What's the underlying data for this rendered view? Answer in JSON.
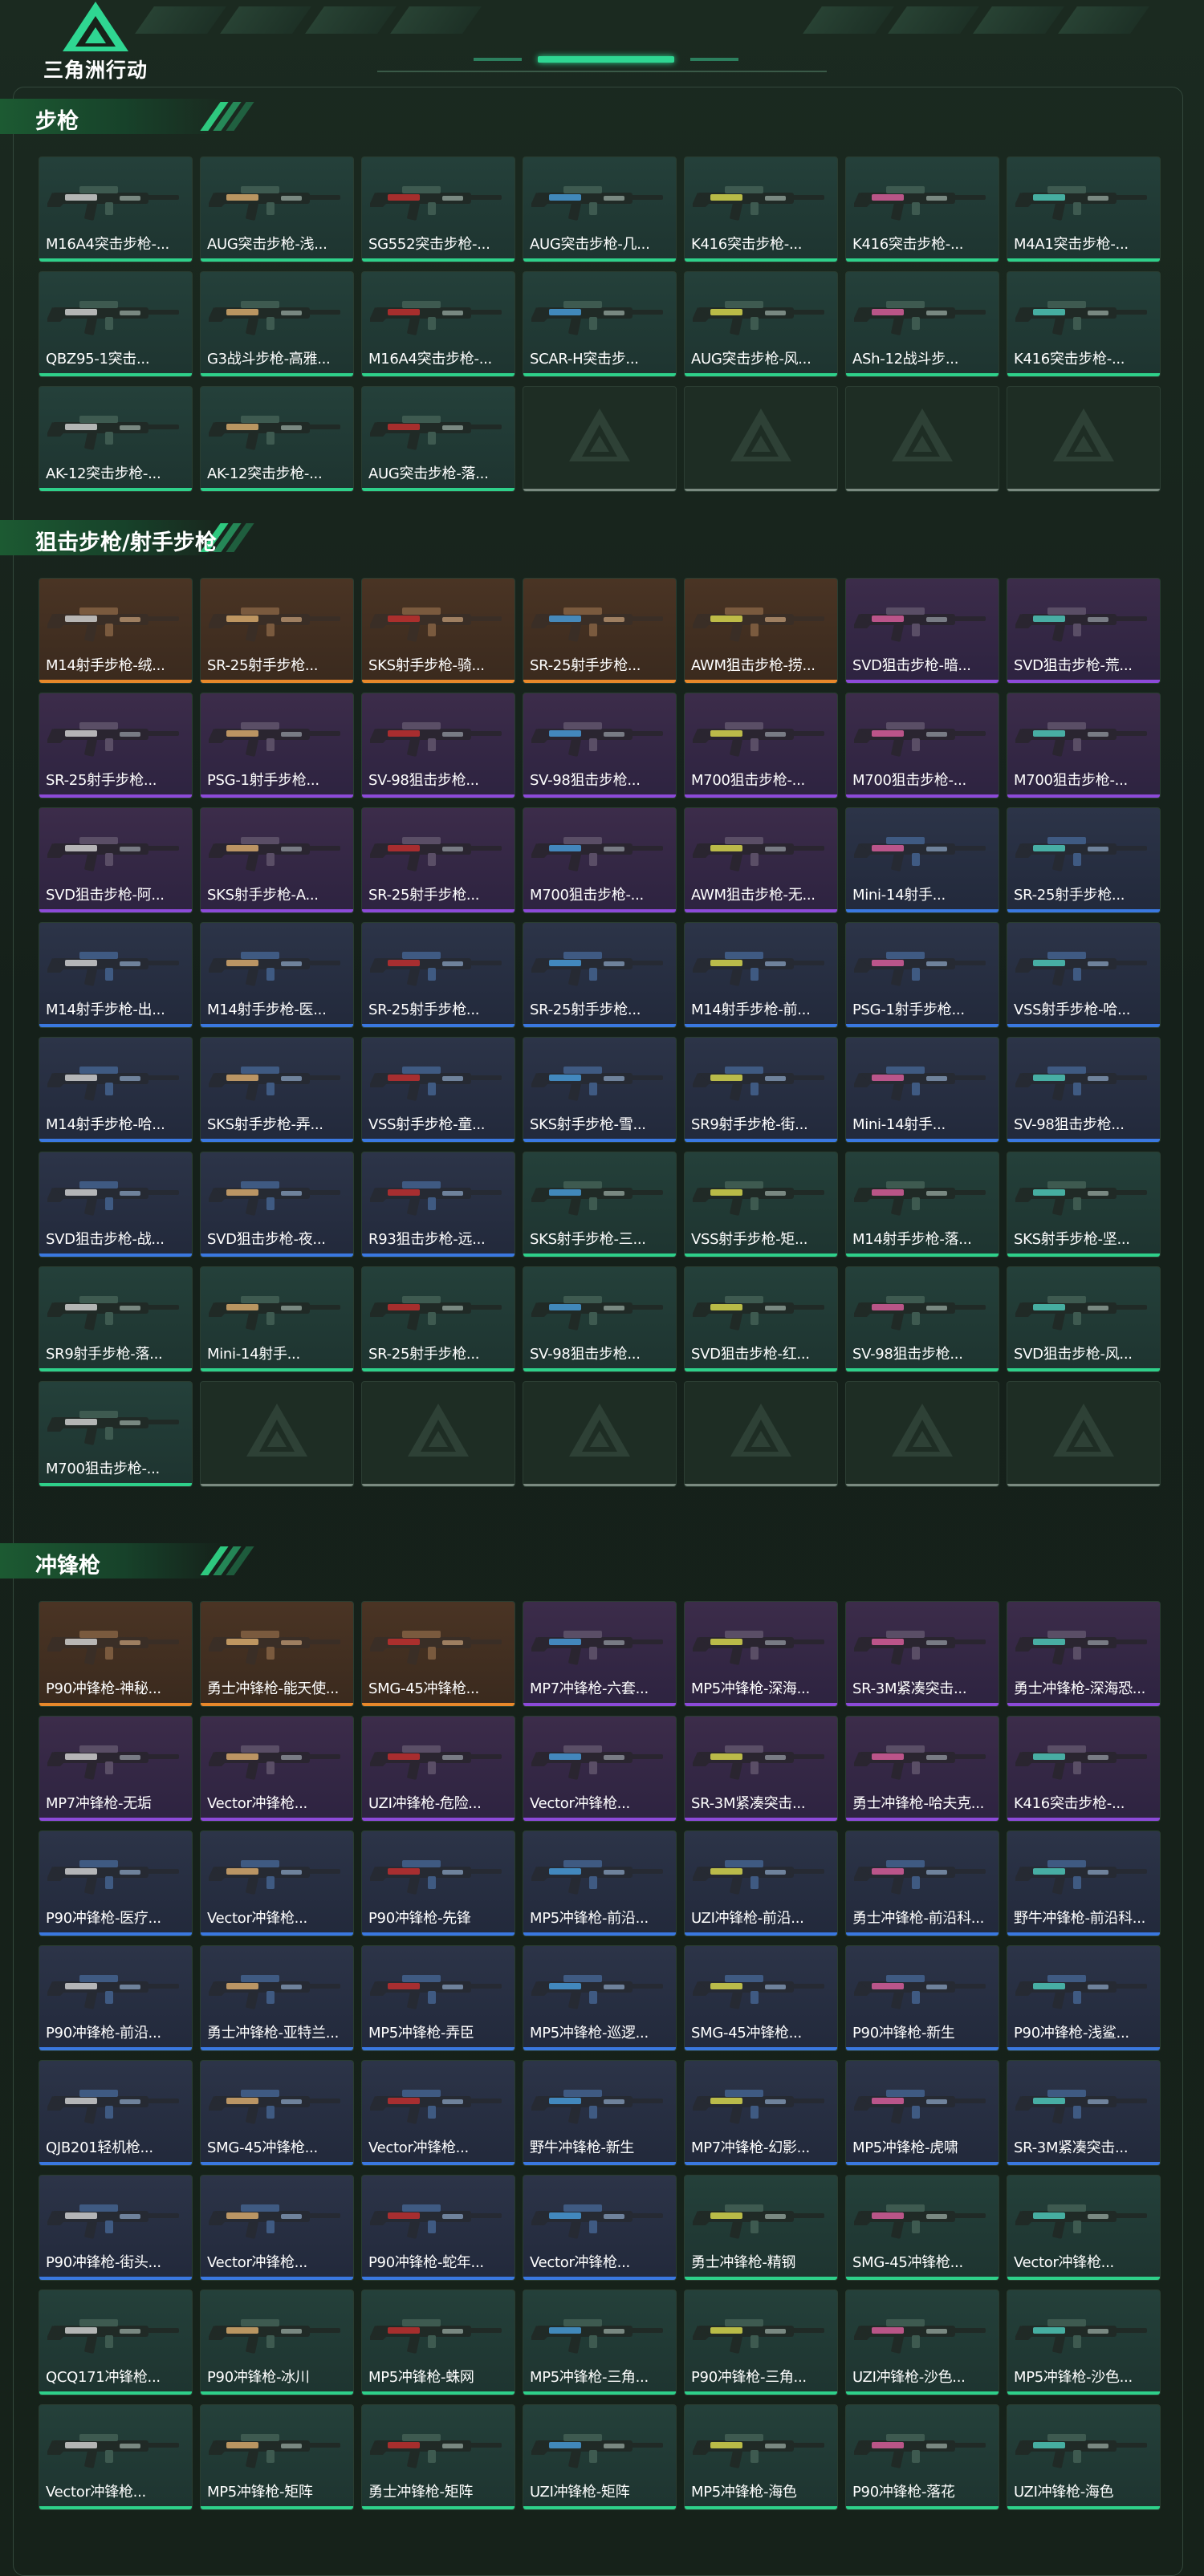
{
  "header": {
    "logo_text": "三角洲行动"
  },
  "sections": [
    {
      "title": "步枪",
      "items": [
        {
          "label": "M16A4突击步枪-...",
          "rarity": "green"
        },
        {
          "label": "AUG突击步枪-浅...",
          "rarity": "green"
        },
        {
          "label": "SG552突击步枪-...",
          "rarity": "green"
        },
        {
          "label": "AUG突击步枪-几...",
          "rarity": "green"
        },
        {
          "label": "K416突击步枪-...",
          "rarity": "green"
        },
        {
          "label": "K416突击步枪-...",
          "rarity": "green"
        },
        {
          "label": "M4A1突击步枪-...",
          "rarity": "green"
        },
        {
          "label": "QBZ95-1突击...",
          "rarity": "green"
        },
        {
          "label": "G3战斗步枪-高雅...",
          "rarity": "green"
        },
        {
          "label": "M16A4突击步枪-...",
          "rarity": "green"
        },
        {
          "label": "SCAR-H突击步...",
          "rarity": "green"
        },
        {
          "label": "AUG突击步枪-风...",
          "rarity": "green"
        },
        {
          "label": "ASh-12战斗步...",
          "rarity": "green"
        },
        {
          "label": "K416突击步枪-...",
          "rarity": "green"
        },
        {
          "label": "AK-12突击步枪-...",
          "rarity": "green"
        },
        {
          "label": "AK-12突击步枪-...",
          "rarity": "green"
        },
        {
          "label": "AUG突击步枪-落...",
          "rarity": "green"
        },
        {
          "label": "",
          "rarity": "empty"
        },
        {
          "label": "",
          "rarity": "empty"
        },
        {
          "label": "",
          "rarity": "empty"
        },
        {
          "label": "",
          "rarity": "empty"
        }
      ]
    },
    {
      "title": "狙击步枪/射手步枪",
      "items": [
        {
          "label": "M14射手步枪-绒...",
          "rarity": "gold"
        },
        {
          "label": "SR-25射手步枪...",
          "rarity": "gold"
        },
        {
          "label": "SKS射手步枪-骑...",
          "rarity": "gold"
        },
        {
          "label": "SR-25射手步枪...",
          "rarity": "gold"
        },
        {
          "label": "AWM狙击步枪-捞...",
          "rarity": "gold"
        },
        {
          "label": "SVD狙击步枪-暗...",
          "rarity": "purple"
        },
        {
          "label": "SVD狙击步枪-荒...",
          "rarity": "purple"
        },
        {
          "label": "SR-25射手步枪...",
          "rarity": "purple"
        },
        {
          "label": "PSG-1射手步枪...",
          "rarity": "purple"
        },
        {
          "label": "SV-98狙击步枪...",
          "rarity": "purple"
        },
        {
          "label": "SV-98狙击步枪...",
          "rarity": "purple"
        },
        {
          "label": "M700狙击步枪-...",
          "rarity": "purple"
        },
        {
          "label": "M700狙击步枪-...",
          "rarity": "purple"
        },
        {
          "label": "M700狙击步枪-...",
          "rarity": "purple"
        },
        {
          "label": "SVD狙击步枪-阿...",
          "rarity": "purple"
        },
        {
          "label": "SKS射手步枪-A...",
          "rarity": "purple"
        },
        {
          "label": "SR-25射手步枪...",
          "rarity": "purple"
        },
        {
          "label": "M700狙击步枪-...",
          "rarity": "purple"
        },
        {
          "label": "AWM狙击步枪-无...",
          "rarity": "purple"
        },
        {
          "label": "Mini-14射手...",
          "rarity": "blue"
        },
        {
          "label": "SR-25射手步枪...",
          "rarity": "blue"
        },
        {
          "label": "M14射手步枪-出...",
          "rarity": "blue"
        },
        {
          "label": "M14射手步枪-医...",
          "rarity": "blue"
        },
        {
          "label": "SR-25射手步枪...",
          "rarity": "blue"
        },
        {
          "label": "SR-25射手步枪...",
          "rarity": "blue"
        },
        {
          "label": "M14射手步枪-前...",
          "rarity": "blue"
        },
        {
          "label": "PSG-1射手步枪...",
          "rarity": "blue"
        },
        {
          "label": "VSS射手步枪-哈...",
          "rarity": "blue"
        },
        {
          "label": "M14射手步枪-哈...",
          "rarity": "blue"
        },
        {
          "label": "SKS射手步枪-弄...",
          "rarity": "blue"
        },
        {
          "label": "VSS射手步枪-童...",
          "rarity": "blue"
        },
        {
          "label": "SKS射手步枪-雪...",
          "rarity": "blue"
        },
        {
          "label": "SR9射手步枪-街...",
          "rarity": "blue"
        },
        {
          "label": "Mini-14射手...",
          "rarity": "blue"
        },
        {
          "label": "SV-98狙击步枪...",
          "rarity": "blue"
        },
        {
          "label": "SVD狙击步枪-战...",
          "rarity": "blue"
        },
        {
          "label": "SVD狙击步枪-夜...",
          "rarity": "blue"
        },
        {
          "label": "R93狙击步枪-远...",
          "rarity": "blue"
        },
        {
          "label": "SKS射手步枪-三...",
          "rarity": "green"
        },
        {
          "label": "VSS射手步枪-矩...",
          "rarity": "green"
        },
        {
          "label": "M14射手步枪-落...",
          "rarity": "green"
        },
        {
          "label": "SKS射手步枪-坚...",
          "rarity": "green"
        },
        {
          "label": "SR9射手步枪-落...",
          "rarity": "green"
        },
        {
          "label": "Mini-14射手...",
          "rarity": "green"
        },
        {
          "label": "SR-25射手步枪...",
          "rarity": "green"
        },
        {
          "label": "SV-98狙击步枪...",
          "rarity": "green"
        },
        {
          "label": "SVD狙击步枪-红...",
          "rarity": "green"
        },
        {
          "label": "SV-98狙击步枪...",
          "rarity": "green"
        },
        {
          "label": "SVD狙击步枪-风...",
          "rarity": "green"
        },
        {
          "label": "M700狙击步枪-...",
          "rarity": "green"
        },
        {
          "label": "",
          "rarity": "empty"
        },
        {
          "label": "",
          "rarity": "empty"
        },
        {
          "label": "",
          "rarity": "empty"
        },
        {
          "label": "",
          "rarity": "empty"
        },
        {
          "label": "",
          "rarity": "empty"
        },
        {
          "label": "",
          "rarity": "empty"
        }
      ]
    },
    {
      "title": "冲锋枪",
      "items": [
        {
          "label": "P90冲锋枪-神秘...",
          "rarity": "gold"
        },
        {
          "label": "勇士冲锋枪-能天使...",
          "rarity": "gold"
        },
        {
          "label": "SMG-45冲锋枪...",
          "rarity": "gold"
        },
        {
          "label": "MP7冲锋枪-六套...",
          "rarity": "purple"
        },
        {
          "label": "MP5冲锋枪-深海...",
          "rarity": "purple"
        },
        {
          "label": "SR-3M紧凑突击...",
          "rarity": "purple"
        },
        {
          "label": "勇士冲锋枪-深海恐...",
          "rarity": "purple"
        },
        {
          "label": "MP7冲锋枪-无垢",
          "rarity": "purple"
        },
        {
          "label": "Vector冲锋枪...",
          "rarity": "purple"
        },
        {
          "label": "UZI冲锋枪-危险...",
          "rarity": "purple"
        },
        {
          "label": "Vector冲锋枪...",
          "rarity": "purple"
        },
        {
          "label": "SR-3M紧凑突击...",
          "rarity": "purple"
        },
        {
          "label": "勇士冲锋枪-哈夫克...",
          "rarity": "purple"
        },
        {
          "label": "K416突击步枪-...",
          "rarity": "purple"
        },
        {
          "label": "P90冲锋枪-医疗...",
          "rarity": "blue"
        },
        {
          "label": "Vector冲锋枪...",
          "rarity": "blue"
        },
        {
          "label": "P90冲锋枪-先锋",
          "rarity": "blue"
        },
        {
          "label": "MP5冲锋枪-前沿...",
          "rarity": "blue"
        },
        {
          "label": "UZI冲锋枪-前沿...",
          "rarity": "blue"
        },
        {
          "label": "勇士冲锋枪-前沿科...",
          "rarity": "blue"
        },
        {
          "label": "野牛冲锋枪-前沿科...",
          "rarity": "blue"
        },
        {
          "label": "P90冲锋枪-前沿...",
          "rarity": "blue"
        },
        {
          "label": "勇士冲锋枪-亚特兰...",
          "rarity": "blue"
        },
        {
          "label": "MP5冲锋枪-弄臣",
          "rarity": "blue"
        },
        {
          "label": "MP5冲锋枪-巡逻...",
          "rarity": "blue"
        },
        {
          "label": "SMG-45冲锋枪...",
          "rarity": "blue"
        },
        {
          "label": "P90冲锋枪-新生",
          "rarity": "blue"
        },
        {
          "label": "P90冲锋枪-浅鲨...",
          "rarity": "blue"
        },
        {
          "label": "QJB201轻机枪...",
          "rarity": "blue"
        },
        {
          "label": "SMG-45冲锋枪...",
          "rarity": "blue"
        },
        {
          "label": "Vector冲锋枪...",
          "rarity": "blue"
        },
        {
          "label": "野牛冲锋枪-新生",
          "rarity": "blue"
        },
        {
          "label": "MP7冲锋枪-幻影...",
          "rarity": "blue"
        },
        {
          "label": "MP5冲锋枪-虎啸",
          "rarity": "blue"
        },
        {
          "label": "SR-3M紧凑突击...",
          "rarity": "blue"
        },
        {
          "label": "P90冲锋枪-街头...",
          "rarity": "blue"
        },
        {
          "label": "Vector冲锋枪...",
          "rarity": "blue"
        },
        {
          "label": "P90冲锋枪-蛇年...",
          "rarity": "blue"
        },
        {
          "label": "Vector冲锋枪...",
          "rarity": "blue"
        },
        {
          "label": "勇士冲锋枪-精钢",
          "rarity": "green"
        },
        {
          "label": "SMG-45冲锋枪...",
          "rarity": "green"
        },
        {
          "label": "Vector冲锋枪...",
          "rarity": "green"
        },
        {
          "label": "QCQ171冲锋枪...",
          "rarity": "green"
        },
        {
          "label": "P90冲锋枪-冰川",
          "rarity": "green"
        },
        {
          "label": "MP5冲锋枪-蛛网",
          "rarity": "green"
        },
        {
          "label": "MP5冲锋枪-三角...",
          "rarity": "green"
        },
        {
          "label": "P90冲锋枪-三角...",
          "rarity": "green"
        },
        {
          "label": "UZI冲锋枪-沙色...",
          "rarity": "green"
        },
        {
          "label": "MP5冲锋枪-沙色...",
          "rarity": "green"
        },
        {
          "label": "Vector冲锋枪...",
          "rarity": "green"
        },
        {
          "label": "MP5冲锋枪-矩阵",
          "rarity": "green"
        },
        {
          "label": "勇士冲锋枪-矩阵",
          "rarity": "green"
        },
        {
          "label": "UZI冲锋枪-矩阵",
          "rarity": "green"
        },
        {
          "label": "MP5冲锋枪-海色",
          "rarity": "green"
        },
        {
          "label": "P90冲锋枪-落花",
          "rarity": "green"
        },
        {
          "label": "UZI冲锋枪-海色",
          "rarity": "green"
        }
      ]
    }
  ],
  "colors": {
    "gold": "#e8882a",
    "purple": "#8c4ad8",
    "blue": "#3a78e0",
    "green": "#2ed08a",
    "accent": "#2fd692"
  },
  "icons": {
    "logo": "delta-triangle-logo-icon",
    "weapon": "rifle-icon",
    "placeholder": "delta-triangle-placeholder-icon"
  }
}
